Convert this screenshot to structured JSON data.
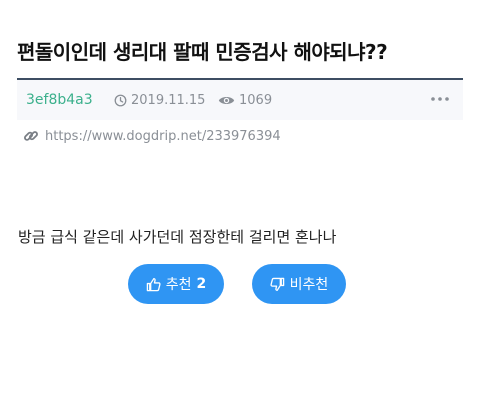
{
  "post": {
    "title": "편돌이인데 생리대 팔때 민증검사 해야되냐??",
    "author": "3ef8b4a3",
    "date": "2019.11.15",
    "views": "1069",
    "source_url": "https://www.dogdrip.net/233976394",
    "content": "방금 급식 같은데 사가던데 점장한테 걸리면 혼나나"
  },
  "votes": {
    "upvote_label": "추천",
    "upvote_count": "2",
    "downvote_label": "비추천"
  },
  "icons": {
    "date": "clock-icon",
    "views": "eye-icon",
    "more": "more-dots-icon",
    "link": "link-icon",
    "upvote": "thumbs-up-icon",
    "downvote": "thumbs-down-icon"
  },
  "colors": {
    "author": "#3bb08c",
    "meta_text": "#8a8f96",
    "meta_border": "#3d4e63",
    "meta_background": "#f7f8fb",
    "button": "#2f95f3"
  }
}
